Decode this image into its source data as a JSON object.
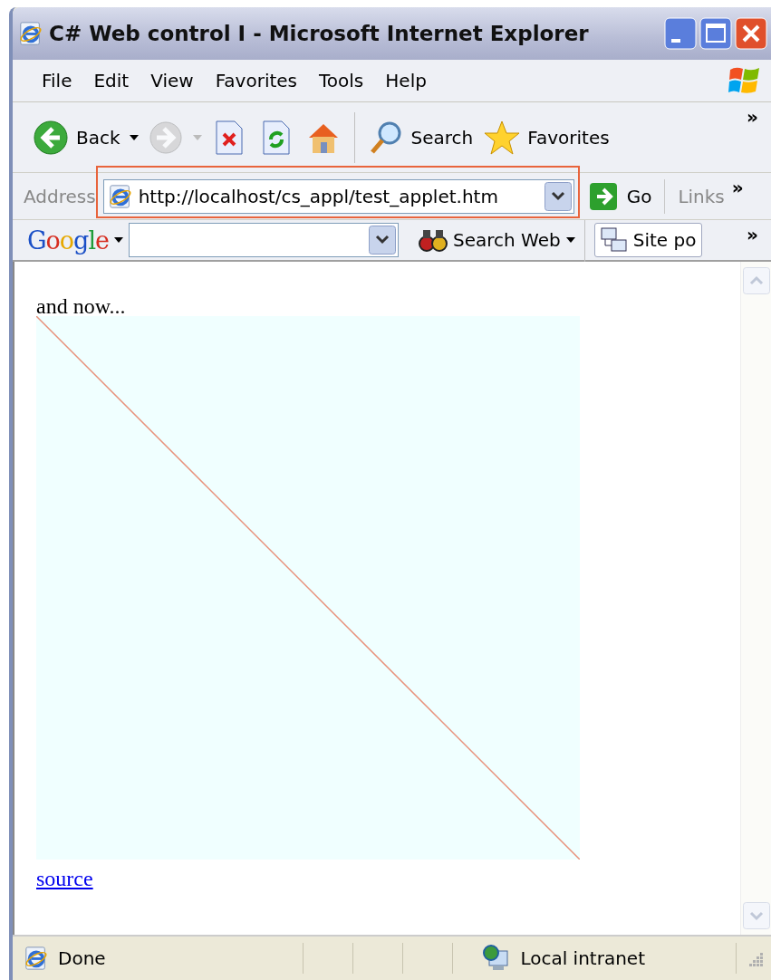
{
  "window": {
    "title": "C# Web control I - Microsoft Internet Explorer"
  },
  "menu": [
    "File",
    "Edit",
    "View",
    "Favorites",
    "Tools",
    "Help"
  ],
  "toolbar": {
    "buttons": [
      {
        "kind": "back",
        "label": "Back",
        "disabled": false
      },
      {
        "kind": "forward",
        "disabled": true
      },
      {
        "kind": "stop",
        "disabled": false
      },
      {
        "kind": "refresh",
        "disabled": false
      },
      {
        "kind": "home",
        "disabled": false
      },
      {
        "kind": "search",
        "label": "Search",
        "disabled": false
      },
      {
        "kind": "favorites",
        "label": "Favorites",
        "disabled": false
      }
    ],
    "more": "»"
  },
  "address_bar": {
    "label": "Address",
    "url": "http://localhost/cs_appl/test_applet.htm",
    "highlighted": true,
    "go": "Go",
    "links": "Links",
    "more": "»"
  },
  "google_bar": {
    "logo": "Google",
    "search_button": "Search Web",
    "site_button": "Site po",
    "more": "»"
  },
  "page": {
    "text": "and now...",
    "link": "source"
  },
  "status_bar": {
    "text": "Done",
    "zone": "Local intranet"
  }
}
